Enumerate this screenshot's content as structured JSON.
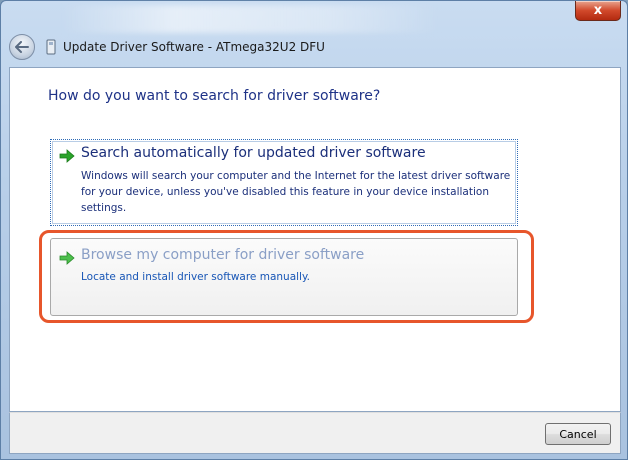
{
  "window": {
    "title": "Update Driver Software - ATmega32U2 DFU",
    "close_label": "x"
  },
  "main": {
    "heading": "How do you want to search for driver software?",
    "options": [
      {
        "title": "Search automatically for updated driver software",
        "description": "Windows will search your computer and the Internet for the latest driver software for your device, unless you've disabled this feature in your device installation settings."
      },
      {
        "title": "Browse my computer for driver software",
        "description": "Locate and install driver software manually."
      }
    ]
  },
  "footer": {
    "cancel_label": "Cancel"
  },
  "colors": {
    "heading": "#1e3287",
    "link": "#1856b6",
    "highlight": "#e7562b",
    "arrow": "#2aa32a"
  }
}
